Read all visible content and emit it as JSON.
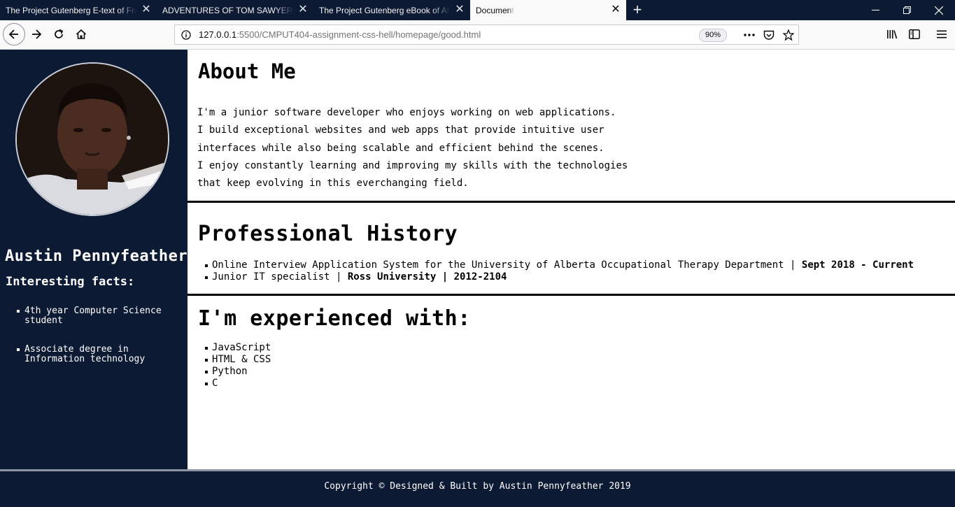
{
  "browser": {
    "tabs": [
      {
        "title": "The Project Gutenberg E-text of Frankenstein"
      },
      {
        "title": "ADVENTURES OF TOM SAWYER, By Mark Twain"
      },
      {
        "title": "The Project Gutenberg eBook of Alice"
      },
      {
        "title": "Document"
      }
    ],
    "new_tab_glyph": "+",
    "url_host": "127.0.0.1",
    "url_path": ":5500/CMPUT404-assignment-css-hell/homepage/good.html",
    "zoom": "90%"
  },
  "sidebar": {
    "name": "Austin Pennyfeather",
    "facts_title": "Interesting facts:",
    "facts": [
      "4th year Computer Science student",
      "Associate degree in Information technology"
    ]
  },
  "about": {
    "heading": "About Me",
    "lines": [
      "I'm a junior software developer who enjoys working on web applications.",
      "I build exceptional websites and web apps that provide intuitive user",
      "interfaces while also being scalable and efficient behind the scenes.",
      "I enjoy constantly learning and improving my skills with the technologies",
      "that keep evolving in this everchanging field."
    ]
  },
  "history": {
    "heading": "Professional History",
    "items": [
      {
        "role": "Online Interview Application System for the University of Alberta Occupational Therapy Department",
        "sep": " | ",
        "detail": "Sept 2018 - Current"
      },
      {
        "role": "Junior IT specialist",
        "sep": " | ",
        "detail": "Ross University | 2012-2104"
      }
    ]
  },
  "skills": {
    "heading": "I'm experienced with:",
    "items": [
      "JavaScript",
      "HTML & CSS",
      "Python",
      "C"
    ]
  },
  "footer": {
    "text": "Copyright © Designed & Built by Austin Pennyfeather 2019"
  },
  "colors": {
    "navy": "#0c1a33",
    "white": "#ffffff"
  }
}
